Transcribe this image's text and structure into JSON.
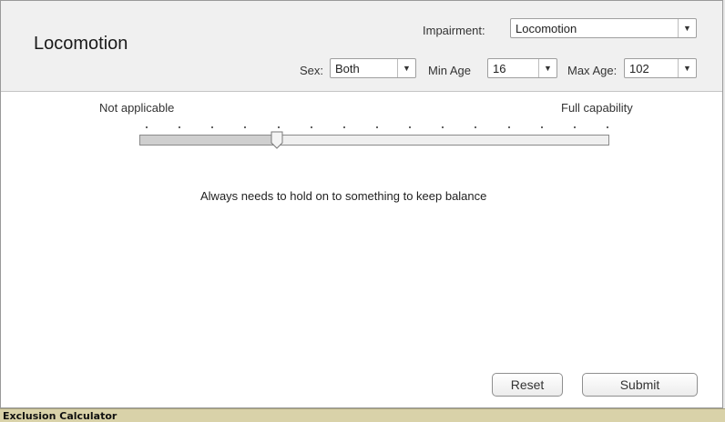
{
  "title": "Locomotion",
  "header": {
    "impairment_label": "Impairment:",
    "impairment_value": "Locomotion",
    "sex_label": "Sex:",
    "sex_value": "Both",
    "min_age_label": "Min Age",
    "min_age_value": "16",
    "max_age_label": "Max Age:",
    "max_age_value": "102"
  },
  "slider": {
    "min_label": "Not applicable",
    "max_label": "Full capability",
    "tick_count": 15,
    "value_fraction": 0.29,
    "description": "Always needs to hold on to something to keep balance"
  },
  "buttons": {
    "reset": "Reset",
    "submit": "Submit"
  },
  "statusbar": {
    "text": "Exclusion Calculator"
  },
  "colors": {
    "statusbar_bg": "#d9d2a9",
    "header_bg": "#f0f0f0"
  },
  "icons": {
    "dropdown": "chevron-down-icon",
    "slider_thumb": "slider-thumb"
  }
}
